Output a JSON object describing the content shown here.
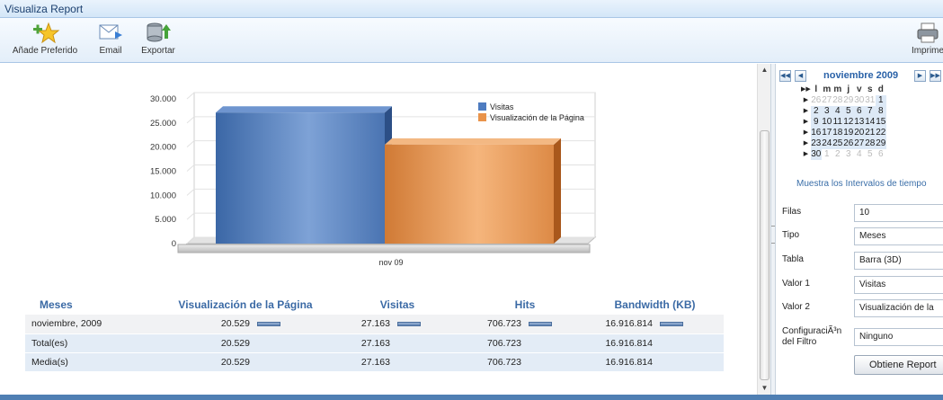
{
  "window": {
    "title": "Visualiza Report"
  },
  "toolbar": {
    "add_favorite": {
      "label": "Añade Preferido",
      "icon": "star-add-icon"
    },
    "email": {
      "label": "Email",
      "icon": "email-icon"
    },
    "export": {
      "label": "Exportar",
      "icon": "database-export-icon"
    },
    "print": {
      "label": "Imprime",
      "icon": "printer-icon"
    }
  },
  "chart_data": {
    "type": "bar",
    "categories": [
      "nov 09"
    ],
    "series": [
      {
        "name": "Visitas",
        "values": [
          27163
        ],
        "color": "#4e7cc0"
      },
      {
        "name": "Visualización de la Página",
        "values": [
          20529
        ],
        "color": "#e9934a"
      }
    ],
    "yticks": [
      "30.000",
      "25.000",
      "20.000",
      "15.000",
      "10.000",
      "5.000",
      "0"
    ],
    "ylim": [
      0,
      30000
    ],
    "legend": "top-right",
    "grid": true,
    "three_d": true
  },
  "table": {
    "headers": [
      "Meses",
      "Visualización de la Página",
      "Visitas",
      "Hits",
      "Bandwidth (KB)"
    ],
    "rows": [
      {
        "label": "noviembre, 2009",
        "cells": [
          "20.529",
          "27.163",
          "706.723",
          "16.916.814"
        ],
        "has_bars": true
      },
      {
        "label": "Total(es)",
        "cells": [
          "20.529",
          "27.163",
          "706.723",
          "16.916.814"
        ],
        "has_bars": false
      },
      {
        "label": "Media(s)",
        "cells": [
          "20.529",
          "27.163",
          "706.723",
          "16.916.814"
        ],
        "has_bars": false
      }
    ]
  },
  "calendar": {
    "month_label": "noviembre 2009",
    "weekday_headers": [
      "l",
      "m",
      "m",
      "j",
      "v",
      "s",
      "d"
    ],
    "weeks": [
      [
        "26",
        "27",
        "28",
        "29",
        "30",
        "31",
        "1"
      ],
      [
        "2",
        "3",
        "4",
        "5",
        "6",
        "7",
        "8"
      ],
      [
        "9",
        "10",
        "11",
        "12",
        "13",
        "14",
        "15"
      ],
      [
        "16",
        "17",
        "18",
        "19",
        "20",
        "21",
        "22"
      ],
      [
        "23",
        "24",
        "25",
        "26",
        "27",
        "28",
        "29"
      ],
      [
        "30",
        "1",
        "2",
        "3",
        "4",
        "5",
        "6"
      ]
    ],
    "intervals_link": "Muestra los Intervalos de tiempo"
  },
  "filters": {
    "filas": {
      "label": "Filas",
      "value": "10"
    },
    "tipo": {
      "label": "Tipo",
      "value": "Meses"
    },
    "tabla": {
      "label": "Tabla",
      "value": "Barra (3D)"
    },
    "valor1": {
      "label": "Valor 1",
      "value": "Visitas"
    },
    "valor2": {
      "label": "Valor 2",
      "value": "Visualización de la"
    },
    "config": {
      "label": "ConfiguraciÃ³n del Filtro",
      "value": "Ninguno"
    },
    "get_button": "Obtiene Report"
  }
}
